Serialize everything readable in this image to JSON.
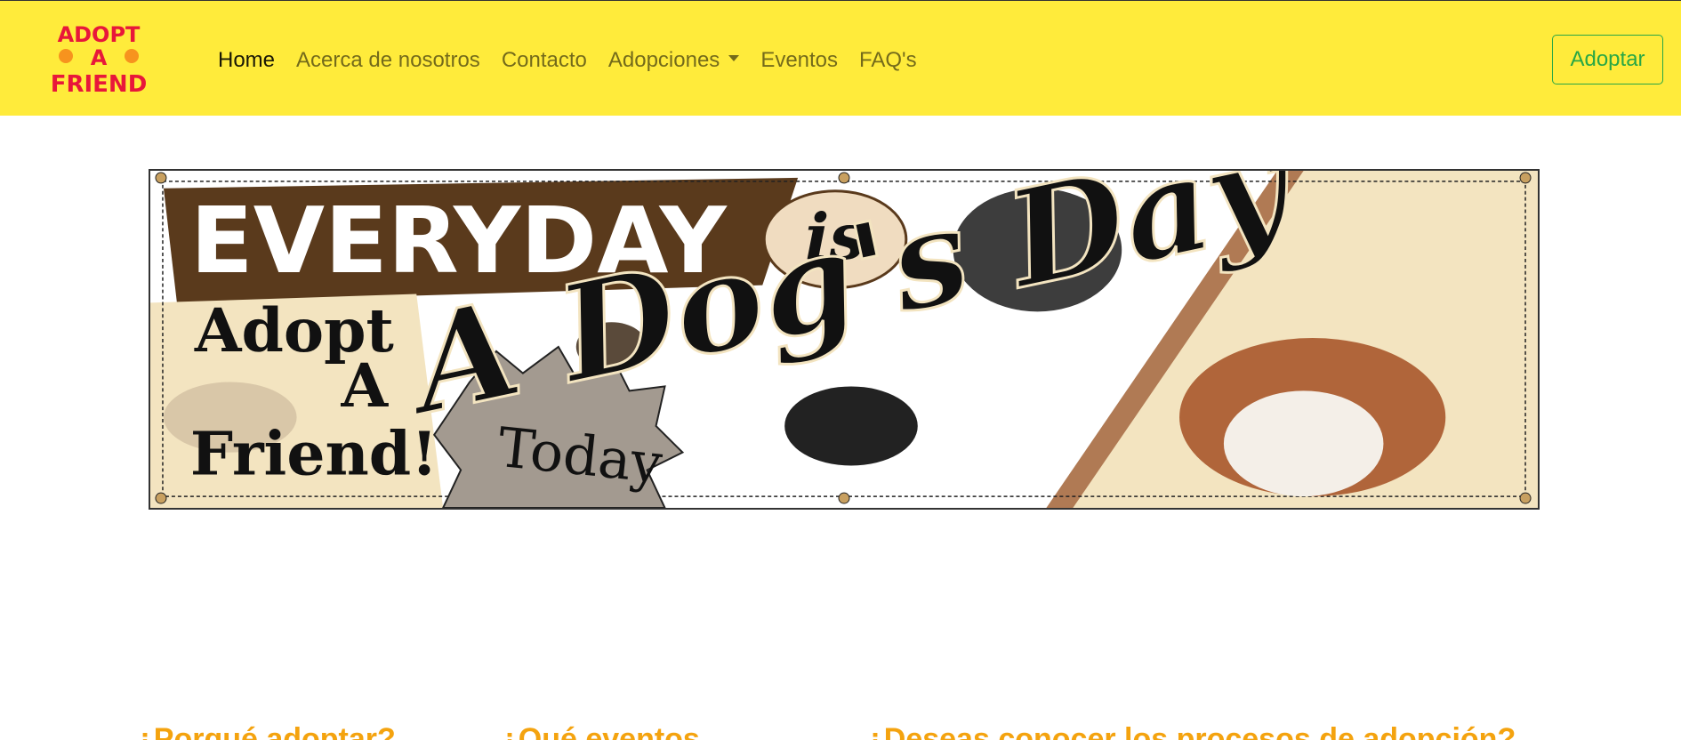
{
  "brand": {
    "logo_text_lines": [
      "ADOPT",
      "A",
      "FRIEND"
    ],
    "logo_colors": {
      "text": "#e8173a",
      "accent": "#f7931e"
    }
  },
  "nav": {
    "items": [
      {
        "label": "Home",
        "active": true
      },
      {
        "label": "Acerca de nosotros"
      },
      {
        "label": "Contacto"
      },
      {
        "label": "Adopciones",
        "dropdown": true
      },
      {
        "label": "Eventos"
      },
      {
        "label": "FAQ's"
      }
    ],
    "cta_label": "Adoptar"
  },
  "banner": {
    "headline": "EVERYDAY",
    "word_is": "is",
    "script_line": "A Dog's Day",
    "left_text_lines": [
      "Adopt",
      "A",
      "Friend!"
    ],
    "badge_text": "Today"
  },
  "sections": {
    "headings": [
      "¿Porqué adoptar?",
      "¿Qué eventos",
      "¿Deseas conocer los procesos de adopción?"
    ]
  },
  "colors": {
    "navbar_bg": "#ffeb3b",
    "cta_green": "#28a745",
    "heading_orange": "#f4a30f"
  }
}
